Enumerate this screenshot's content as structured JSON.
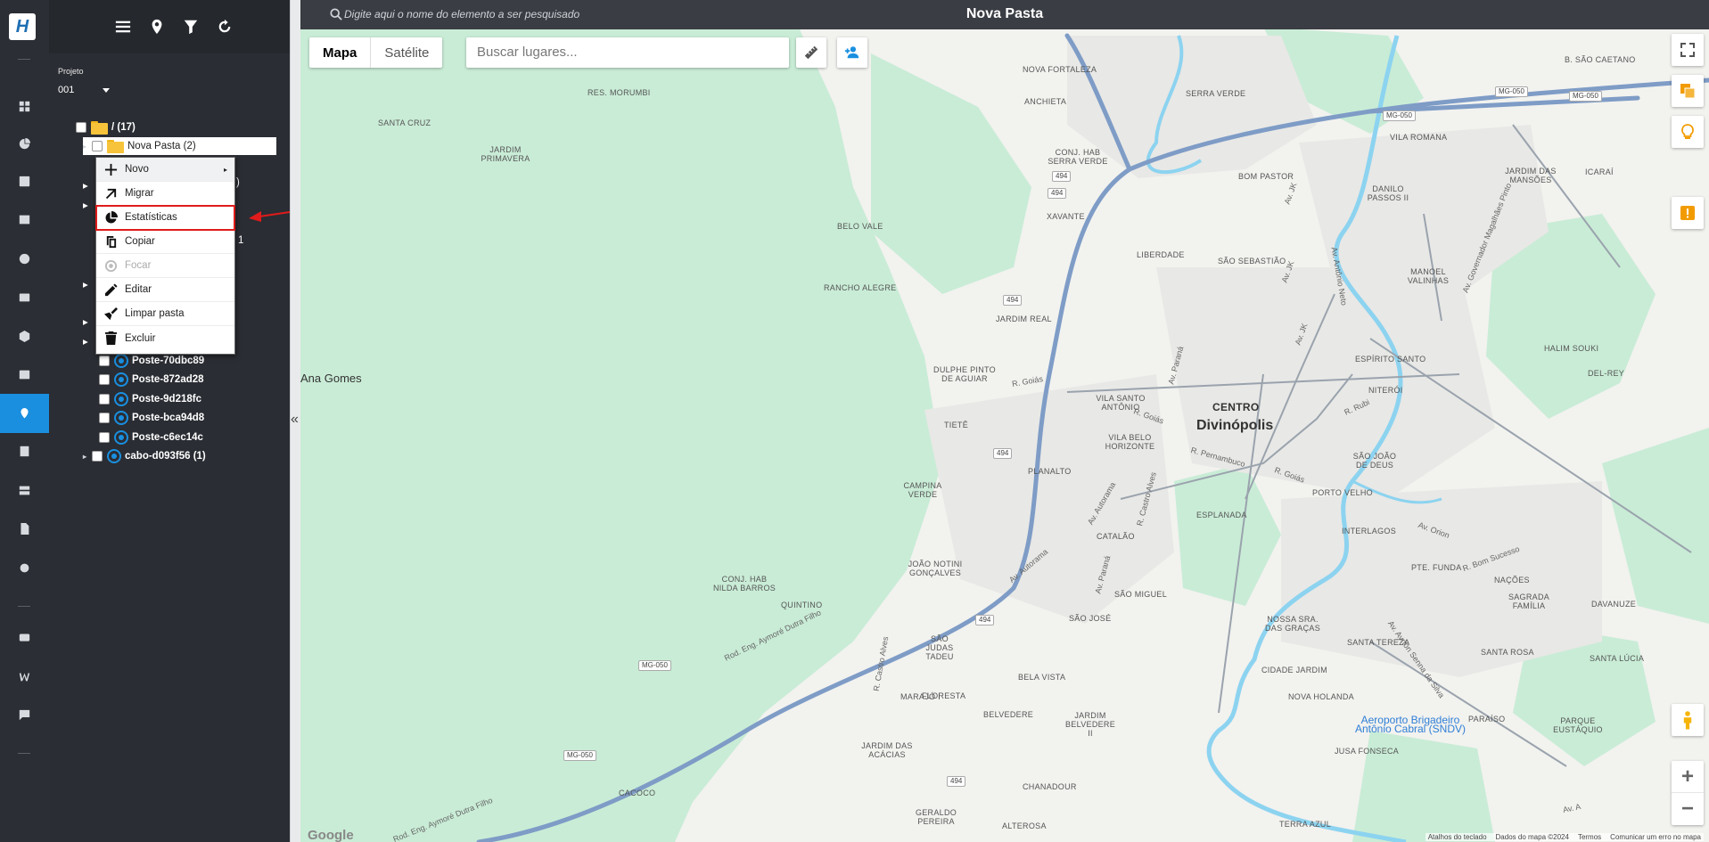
{
  "rail": {
    "logo": "H",
    "items": [
      "dashboard",
      "chart",
      "person-card",
      "book",
      "clock",
      "id-card",
      "cube",
      "account",
      "map-pin",
      "list",
      "server",
      "document",
      "settings",
      "video",
      "w-brand",
      "message"
    ]
  },
  "toolbar": {
    "icons": [
      "menu-icon",
      "location-icon",
      "filter-icon",
      "refresh-icon"
    ]
  },
  "project": {
    "label": "Projeto",
    "value": "001"
  },
  "tree": {
    "root": "/ (17)",
    "folder": "Nova Pasta (2)",
    "hidden_fragments": [
      ")",
      "1"
    ],
    "items": [
      {
        "label": "Poste-70dbc89"
      },
      {
        "label": "Poste-872ad28"
      },
      {
        "label": "Poste-9d218fc"
      },
      {
        "label": "Poste-bca94d8"
      },
      {
        "label": "Poste-c6ec14c"
      },
      {
        "label": "cabo-d093f56 (1)"
      }
    ]
  },
  "context_menu": {
    "items": [
      {
        "label": "Novo",
        "icon": "plus-icon",
        "submenu": true
      },
      {
        "label": "Migrar",
        "icon": "arrow-up-right-icon"
      },
      {
        "label": "Estatísticas",
        "icon": "pie-chart-icon",
        "highlighted": true
      },
      {
        "label": "Copiar",
        "icon": "copy-icon"
      },
      {
        "label": "Focar",
        "icon": "focus-icon",
        "disabled": true
      },
      {
        "label": "Editar",
        "icon": "pencil-icon"
      },
      {
        "label": "Limpar pasta",
        "icon": "broom-icon"
      },
      {
        "label": "Excluir",
        "icon": "trash-icon"
      }
    ]
  },
  "collapse": "«",
  "map": {
    "search_placeholder": "Digite aqui o nome do elemento a ser pesquisado",
    "title": "Nova Pasta",
    "type_buttons": {
      "map": "Mapa",
      "satellite": "Satélite"
    },
    "places_placeholder": "Buscar lugares...",
    "zoom_in": "+",
    "zoom_out": "−",
    "google": "Google",
    "footer": [
      "Atalhos do teclado",
      "Dados do mapa ©2024",
      "Termos",
      "Comunicar um erro no mapa"
    ],
    "labels": {
      "city": "Divinópolis",
      "centro": "CENTRO",
      "ana_gomes": "Ana Gomes",
      "airport": "Aeroporto Brigadeiro Antônio Cabral (SNDV)",
      "b_sao_caetano": "B. SÃO CAETANO",
      "nova_fortaleza": "NOVA FORTALEZA",
      "res_morumbi": "RES. MORUMBI",
      "santa cruz": "SANTA CRUZ",
      "anchieta": "ANCHIETA",
      "serra_verde": "SERRA VERDE",
      "jardim_primavera": "JARDIM PRIMAVERA",
      "conj_hab_serra_verde": "CONJ. HAB SERRA VERDE",
      "vila_romana": "VILA ROMANA",
      "icarai": "ICARAÍ",
      "bom_pastor": "BOM PASTOR",
      "danilo_passos": "DANILO PASSOS II",
      "jardim_das_mansoes": "JARDIM DAS MANSÕES",
      "xavante": "XAVANTE",
      "belo_vale": "BELO VALE",
      "liberdade": "LIBERDADE",
      "sao_sebastiao": "SÃO SEBASTIÃO",
      "manoel_valinhas": "MANOEL VALINHAS",
      "rancho_alegre": "RANCHO ALEGRE",
      "jardim_real": "JARDIM REAL",
      "halim_souki": "HALIM SOUKI",
      "espirito_santo": "ESPÍRITO SANTO",
      "del_rey": "DEL-REY",
      "dulphe": "DULPHE PINTO DE AGUIAR",
      "vila_santo_antonio": "VILA SANTO ANTÔNIO",
      "niteroi": "NITERÓI",
      "tiete": "TIETÊ",
      "vila_belo_horizonte": "VILA BELO HORIZONTE",
      "sao_joao_de_deus": "SÃO JOÃO DE DEUS",
      "planalto": "PLANALTO",
      "porto_velho": "PORTO VELHO",
      "campina_verde": "CAMPINA VERDE",
      "esplanada": "ESPLANADA",
      "catalao": "CATALÃO",
      "interlagos": "INTERLAGOS",
      "pte_funda": "PTE. FUNDA",
      "joao_notini": "JOÃO NOTINI GONÇALVES",
      "conj_hab_nilda": "CONJ. HAB NILDA BARROS",
      "sao_miguel": "SÃO MIGUEL",
      "nacoes": "NAÇÕES",
      "quintino": "QUINTINO",
      "sagrada_familia": "SAGRADA FAMÍLIA",
      "davanuze": "DAVANUZE",
      "sao_judas": "SÃO JUDAS TADEU",
      "sao_jose": "SÃO JOSÉ",
      "nossa_sra_gracas": "NOSSA SRA. DAS GRAÇAS",
      "santa_tereza": "SANTA TEREZA",
      "santa_rosa": "SANTA ROSA",
      "santa_lucia": "SANTA LÚCIA",
      "cidade_jardim": "CIDADE JARDIM",
      "floresta": "FLORESTA",
      "bela_vista": "BELA VISTA",
      "nova_holanda": "NOVA HOLANDA",
      "belvedere": "BELVEDERE",
      "jardim_belvedere": "JARDIM BELVEDERE II",
      "paraiso": "PARAÍSO",
      "parque_eustaquio": "PARQUE EUSTÁQUIO",
      "maraje": "MARAJÓ I",
      "jardim_das_acacias": "JARDIM DAS ACÁCIAS",
      "jusa_fonseca": "JUSA FONSECA",
      "chanadour": "CHANADOUR",
      "cacoco": "CACOCO",
      "geraldo_pereira": "GERALDO PEREIRA",
      "alterosa": "ALTEROSA",
      "terra_azul": "TERRA AZUL"
    },
    "roads": {
      "mg050": "MG-050",
      "r494": "494",
      "rod_eng": "Rod. Eng. Aymoré Dutra Filho",
      "av_autorama": "Av. Autorama",
      "r_goias": "R. Goiás",
      "av_parana": "Av. Paraná",
      "r_pernambuco": "R. Pernambuco",
      "r_rubi": "R. Rubi",
      "av_jk": "Av. JK",
      "av_orion": "Av. Orion",
      "r_bom_sucesso": "R. Bom Sucesso",
      "av_ayrton": "Av. Ayrton Senna da Silva",
      "av_antonio_neto": "Av. Antônio Neto",
      "av_gov_magalhaes": "Av. Governador Magalhães Pinto",
      "r_castro_alves": "R. Castro Alves",
      "av_a": "Av. A"
    }
  },
  "colors": {
    "accent": "#1a8fe0",
    "rail_bg": "#2b2e34",
    "map_green": "#c9ecd6",
    "river": "#8cd3f0",
    "highway": "#7e9cc6",
    "highlight_border": "#e01b1b"
  }
}
